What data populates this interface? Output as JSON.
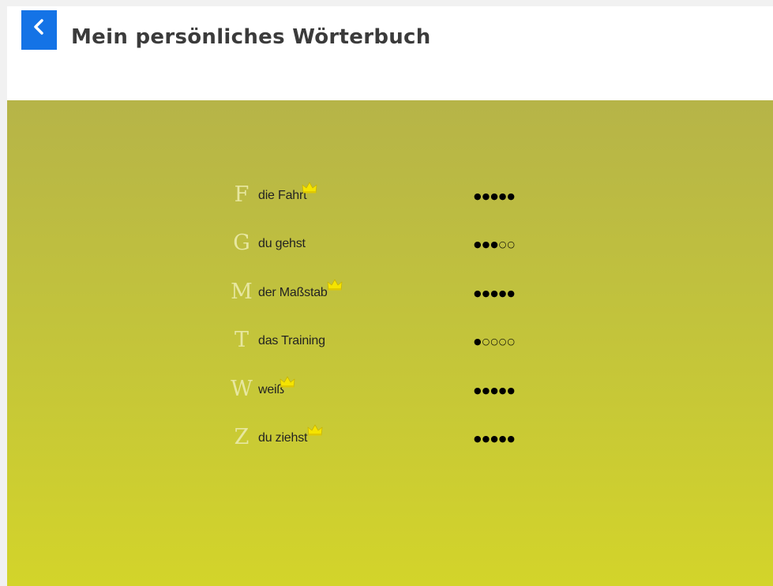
{
  "header": {
    "title": "Mein persönliches Wörterbuch",
    "back_icon": "chevron-left-icon",
    "accent_color": "#1473e6"
  },
  "words": [
    {
      "letter": "F",
      "word": "die Fahrt",
      "crown": true,
      "level": 5,
      "max_level": 5,
      "dots": "●●●●●"
    },
    {
      "letter": "G",
      "word": "du gehst",
      "crown": false,
      "level": 3,
      "max_level": 5,
      "dots": "●●●○○"
    },
    {
      "letter": "M",
      "word": "der Maßstab",
      "crown": true,
      "level": 5,
      "max_level": 5,
      "dots": "●●●●●"
    },
    {
      "letter": "T",
      "word": "das Training",
      "crown": false,
      "level": 1,
      "max_level": 5,
      "dots": "●○○○○"
    },
    {
      "letter": "W",
      "word": "weiß",
      "crown": true,
      "level": 5,
      "max_level": 5,
      "dots": "●●●●●"
    },
    {
      "letter": "Z",
      "word": "du ziehst",
      "crown": true,
      "level": 5,
      "max_level": 5,
      "dots": "●●●●●"
    }
  ],
  "colors": {
    "background_top": "#b6b448",
    "background_bottom": "#d3d42a",
    "crown": "#f5e400"
  }
}
